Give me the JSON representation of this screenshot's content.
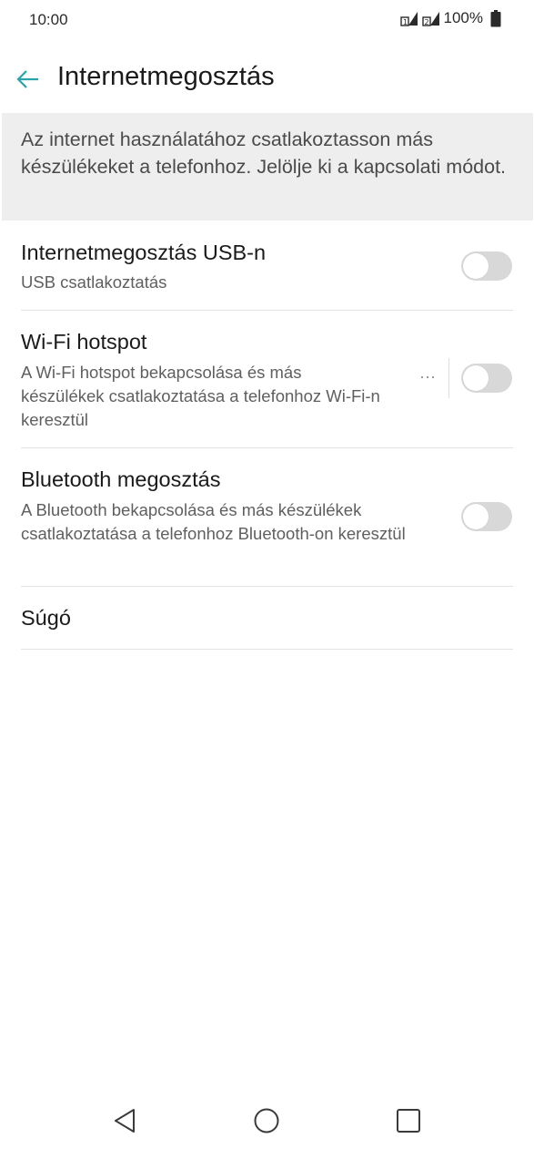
{
  "status_bar": {
    "time": "10:00",
    "battery_percent": "100%",
    "icons": [
      "sim1-signal-icon",
      "sim2-signal-icon",
      "battery-icon"
    ]
  },
  "app_bar": {
    "back_icon": "arrow-back-icon",
    "title": "Internetmegosztás",
    "accent_color": "#2aa4a8"
  },
  "info_banner": {
    "text": "Az internet használatához csatlakoztasson más készülékeket a telefonhoz. Jelölje ki a kapcsolati módot."
  },
  "settings": [
    {
      "title": "Internetmegosztás USB-n",
      "subtitle": "USB csatlakoztatás",
      "toggle_on": false
    },
    {
      "title": "Wi-Fi hotspot",
      "subtitle": "A Wi-Fi hotspot bekapcsolása és más készülékek csatlakoztatása a telefonhoz Wi-Fi-n keresztül",
      "toggle_on": false,
      "more_label": "···"
    },
    {
      "title": "Bluetooth megosztás",
      "subtitle": "A Bluetooth bekapcsolása és más készülékek csatlakoztatása a telefonhoz Bluetooth-on keresztül",
      "toggle_on": false
    },
    {
      "title": "Súgó"
    }
  ],
  "nav_bar": {
    "buttons": [
      "back-triangle-icon",
      "home-circle-icon",
      "recents-square-icon"
    ]
  }
}
